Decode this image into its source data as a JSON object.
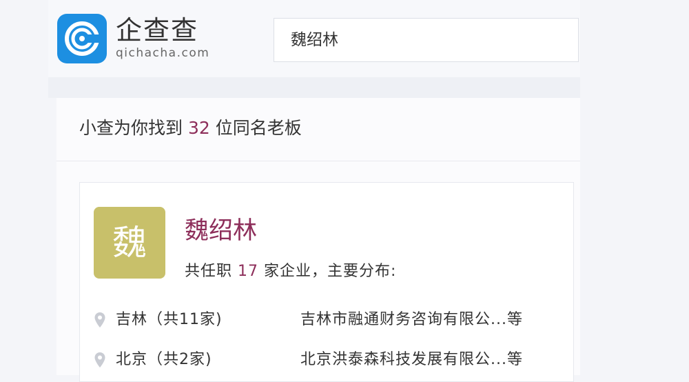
{
  "brand": {
    "name_cn": "企查查",
    "name_en": "qichacha.com"
  },
  "search": {
    "value": "魏绍林"
  },
  "results": {
    "prefix": "小查为你找到",
    "count": "32",
    "suffix": "位同名老板"
  },
  "person": {
    "avatar_char": "魏",
    "name": "魏绍林",
    "summary_prefix": "共任职",
    "company_count": "17",
    "summary_suffix": "家企业，主要分布:",
    "locations": [
      {
        "label": "吉林（共11家)",
        "company": "吉林市融通财务咨询有限公...等"
      },
      {
        "label": "北京（共2家)",
        "company": "北京洪泰森科技发展有限公...等"
      }
    ]
  },
  "colors": {
    "brand_blue": "#1d8fe1",
    "accent": "#8d2e5a",
    "avatar_bg": "#c8c06a"
  }
}
